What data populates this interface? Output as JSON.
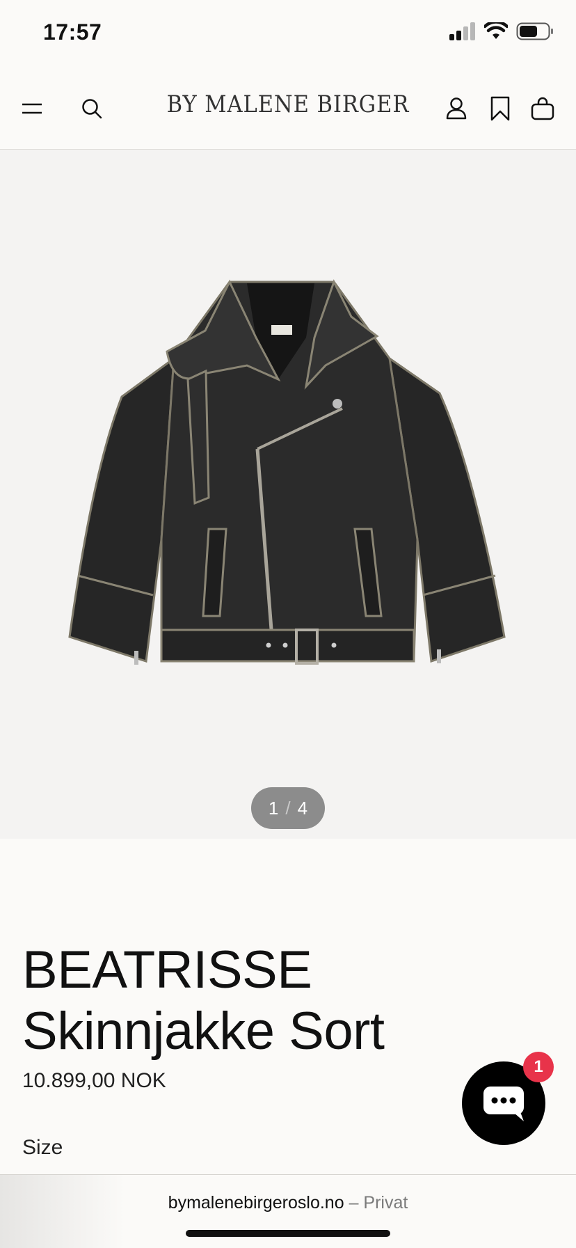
{
  "status_bar": {
    "time": "17:57"
  },
  "header": {
    "logo": "BY MALENE BIRGER",
    "icons": [
      "menu-icon",
      "search-icon",
      "account-icon",
      "wishlist-icon",
      "cart-icon"
    ]
  },
  "gallery": {
    "current": "1",
    "separator": "/",
    "total": "4"
  },
  "product": {
    "title": "BEATRISSE Skinnjakke Sort",
    "price": "10.899,00 NOK",
    "size_label": "Size"
  },
  "chat": {
    "badge": "1"
  },
  "browser": {
    "domain": "bymalenebirgeroslo.no",
    "mode": "– Privat"
  }
}
